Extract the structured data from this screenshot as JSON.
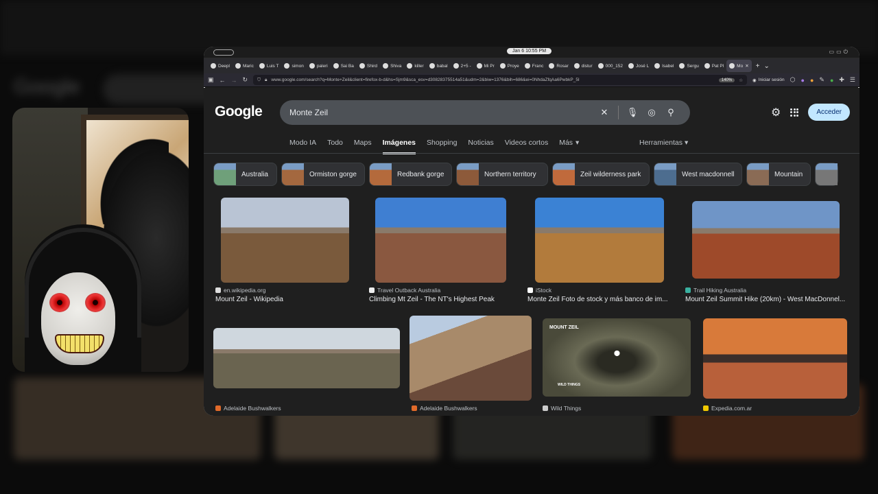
{
  "browser": {
    "clock": "Jan 6  10:55 PM",
    "tabs": [
      {
        "label": "Deepl"
      },
      {
        "label": "Maric"
      },
      {
        "label": "Luis T"
      },
      {
        "label": "simon"
      },
      {
        "label": "paleri"
      },
      {
        "label": "Sai Ba"
      },
      {
        "label": "Shird"
      },
      {
        "label": "Shiva"
      },
      {
        "label": "killer"
      },
      {
        "label": "babal"
      },
      {
        "label": "2+5 -"
      },
      {
        "label": "Mi Pr"
      },
      {
        "label": "Proye"
      },
      {
        "label": "Franc"
      },
      {
        "label": "Rosar"
      },
      {
        "label": "distur"
      },
      {
        "label": "000_152"
      },
      {
        "label": "José L"
      },
      {
        "label": "Isabel"
      },
      {
        "label": "Sergu"
      },
      {
        "label": "Pat Pl"
      },
      {
        "label": "Mo",
        "active": true
      }
    ],
    "url": "www.google.com/search?q=Monte+Zeil&client=firefox-b-d&hs=Sjm9&sca_esv=d30828375514a51&udm=2&biw=1376&bih=686&ei=0NhdaZfqAa6PwbkP_5I",
    "zoom": "140%",
    "signin_label": "Iniciar sesión"
  },
  "google": {
    "logo": "Google",
    "query": "Monte Zeil",
    "acceder": "Acceder",
    "nav": [
      "Modo IA",
      "Todo",
      "Maps",
      "Imágenes",
      "Shopping",
      "Noticias",
      "Videos cortos",
      "Más"
    ],
    "nav_selected": "Imágenes",
    "tools": "Herramientas",
    "chips": [
      {
        "label": "Australia",
        "color": "#6fa07a"
      },
      {
        "label": "Ormiston gorge",
        "color": "#a4683f"
      },
      {
        "label": "Redbank gorge",
        "color": "#b46a3c"
      },
      {
        "label": "Northern territory",
        "color": "#8d5a3a"
      },
      {
        "label": "Zeil wilderness park",
        "color": "#c06a3c"
      },
      {
        "label": "West macdonnell",
        "color": "#4d6d8f"
      },
      {
        "label": "Mountain",
        "color": "#8a6b55"
      },
      {
        "label": "",
        "color": "#777"
      }
    ],
    "results": [
      {
        "source": "en.wikipedia.org",
        "title": "Mount Zeil - Wikipedia",
        "icon": "wikipedia-icon"
      },
      {
        "source": "Travel Outback Australia",
        "title": "Climbing Mt Zeil - The NT's Highest Peak",
        "icon": "site-icon"
      },
      {
        "source": "iStock",
        "title": "Monte Zeil Foto de stock y más banco de im...",
        "icon": "istock-icon"
      },
      {
        "source": "Trail Hiking Australia",
        "title": "Mount Zeil Summit Hike (20km) - West MacDonnel...",
        "icon": "trail-icon"
      },
      {
        "source": "Adelaide Bushwalkers",
        "title": "",
        "icon": "site-icon"
      },
      {
        "source": "Adelaide Bushwalkers",
        "title": "",
        "icon": "site-icon"
      },
      {
        "source": "Wild Things",
        "title": "",
        "icon": "site-icon"
      },
      {
        "source": "Expedia.com.ar",
        "title": "",
        "icon": "expedia-icon"
      }
    ],
    "map_label": "MOUNT ZEIL",
    "wild_label": "WILD THINGS"
  }
}
